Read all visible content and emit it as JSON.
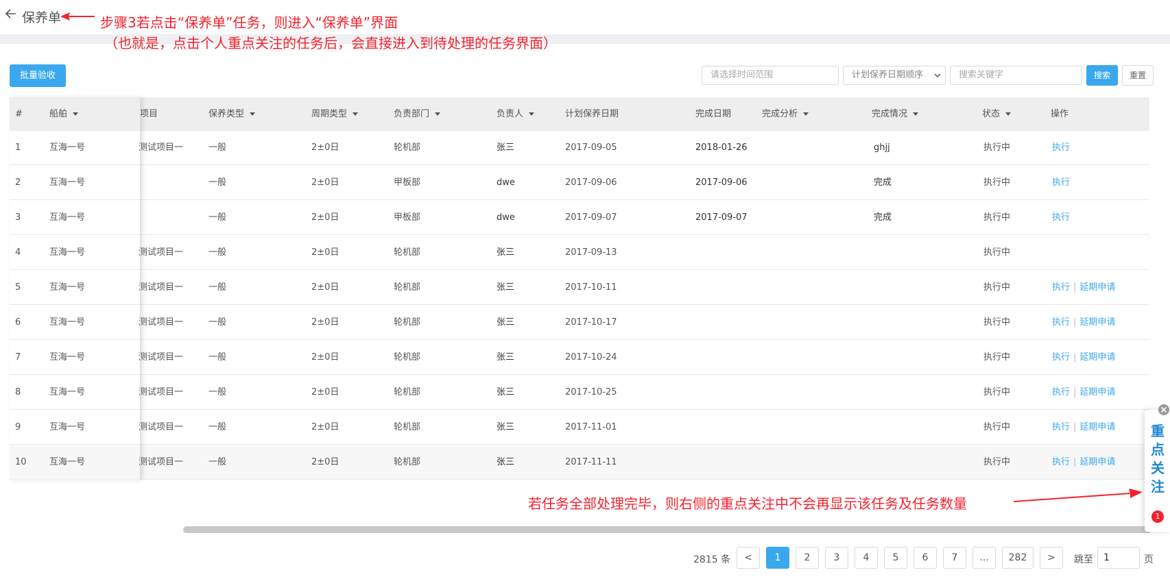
{
  "header": {
    "title": "保养单"
  },
  "annotations": {
    "top_line1": "步骤3若点击“保养单”任务，则进入“保养单”界面",
    "top_line2": "（也就是，点击个人重点关注的任务后，会直接进入到待处理的任务界面）",
    "bottom": "若任务全部处理完毕，则右侧的重点关注中不会再显示该任务及任务数量",
    "color": "#f5222d"
  },
  "toolbar": {
    "batch_accept": "批量验收",
    "time_range_placeholder": "请选择时间范围",
    "sort_select": "计划保养日期顺序",
    "keyword_placeholder": "搜索关键字",
    "search": "搜索",
    "reset": "重置"
  },
  "table": {
    "headers": {
      "index": "#",
      "ship": "船舶",
      "project": "项目",
      "type": "保养类型",
      "cycle": "周期类型",
      "dept": "负责部门",
      "owner": "负责人",
      "plan_date": "计划保养日期",
      "done_date": "完成日期",
      "analysis": "完成分析",
      "done_status": "完成情况",
      "status": "状态",
      "ops": "操作"
    },
    "rows": [
      {
        "index": "1",
        "ship": "互海一号",
        "project": "测试项目一",
        "type": "一般",
        "cycle": "2±0日",
        "dept": "轮机部",
        "owner": "张三",
        "plan_date": "2017-09-05",
        "done_date": "2018-01-26",
        "analysis": "",
        "done_status": "ghjj",
        "status": "执行中",
        "op1": "执行",
        "op2": ""
      },
      {
        "index": "2",
        "ship": "互海一号",
        "project": "",
        "type": "一般",
        "cycle": "2±0日",
        "dept": "甲板部",
        "owner": "dwe",
        "plan_date": "2017-09-06",
        "done_date": "2017-09-06",
        "analysis": "",
        "done_status": "完成",
        "status": "执行中",
        "op1": "执行",
        "op2": ""
      },
      {
        "index": "3",
        "ship": "互海一号",
        "project": "",
        "type": "一般",
        "cycle": "2±0日",
        "dept": "甲板部",
        "owner": "dwe",
        "plan_date": "2017-09-07",
        "done_date": "2017-09-07",
        "analysis": "",
        "done_status": "完成",
        "status": "执行中",
        "op1": "执行",
        "op2": ""
      },
      {
        "index": "4",
        "ship": "互海一号",
        "project": "测试项目一",
        "type": "一般",
        "cycle": "2±0日",
        "dept": "轮机部",
        "owner": "张三",
        "plan_date": "2017-09-13",
        "done_date": "",
        "analysis": "",
        "done_status": "",
        "status": "执行中",
        "op1": "",
        "op2": ""
      },
      {
        "index": "5",
        "ship": "互海一号",
        "project": "测试项目一",
        "type": "一般",
        "cycle": "2±0日",
        "dept": "轮机部",
        "owner": "张三",
        "plan_date": "2017-10-11",
        "done_date": "",
        "analysis": "",
        "done_status": "",
        "status": "执行中",
        "op1": "执行",
        "op2": "延期申请"
      },
      {
        "index": "6",
        "ship": "互海一号",
        "project": "测试项目一",
        "type": "一般",
        "cycle": "2±0日",
        "dept": "轮机部",
        "owner": "张三",
        "plan_date": "2017-10-17",
        "done_date": "",
        "analysis": "",
        "done_status": "",
        "status": "执行中",
        "op1": "执行",
        "op2": "延期申请"
      },
      {
        "index": "7",
        "ship": "互海一号",
        "project": "测试项目一",
        "type": "一般",
        "cycle": "2±0日",
        "dept": "轮机部",
        "owner": "张三",
        "plan_date": "2017-10-24",
        "done_date": "",
        "analysis": "",
        "done_status": "",
        "status": "执行中",
        "op1": "执行",
        "op2": "延期申请"
      },
      {
        "index": "8",
        "ship": "互海一号",
        "project": "测试项目一",
        "type": "一般",
        "cycle": "2±0日",
        "dept": "轮机部",
        "owner": "张三",
        "plan_date": "2017-10-25",
        "done_date": "",
        "analysis": "",
        "done_status": "",
        "status": "执行中",
        "op1": "执行",
        "op2": "延期申请"
      },
      {
        "index": "9",
        "ship": "互海一号",
        "project": "测试项目一",
        "type": "一般",
        "cycle": "2±0日",
        "dept": "轮机部",
        "owner": "张三",
        "plan_date": "2017-11-01",
        "done_date": "",
        "analysis": "",
        "done_status": "",
        "status": "执行中",
        "op1": "执行",
        "op2": "延期申请"
      },
      {
        "index": "10",
        "ship": "互海一号",
        "project": "测试项目一",
        "type": "一般",
        "cycle": "2±0日",
        "dept": "轮机部",
        "owner": "张三",
        "plan_date": "2017-11-11",
        "done_date": "",
        "analysis": "",
        "done_status": "",
        "status": "执行中",
        "op1": "执行",
        "op2": "延期申请"
      }
    ]
  },
  "pagination": {
    "total": "2815 条",
    "prev": "<",
    "next": ">",
    "pages": [
      "1",
      "2",
      "3",
      "4",
      "5",
      "6",
      "7",
      "...",
      "282"
    ],
    "active": "1",
    "jump_label": "跳至",
    "jump_value": "1",
    "page_unit": "页"
  },
  "focus_panel": {
    "chars": [
      "重",
      "点",
      "关",
      "注"
    ],
    "count": "1"
  },
  "colors": {
    "primary": "#3aa8ee",
    "annotation": "#f5222d",
    "focus_text": "#1e88d4"
  }
}
